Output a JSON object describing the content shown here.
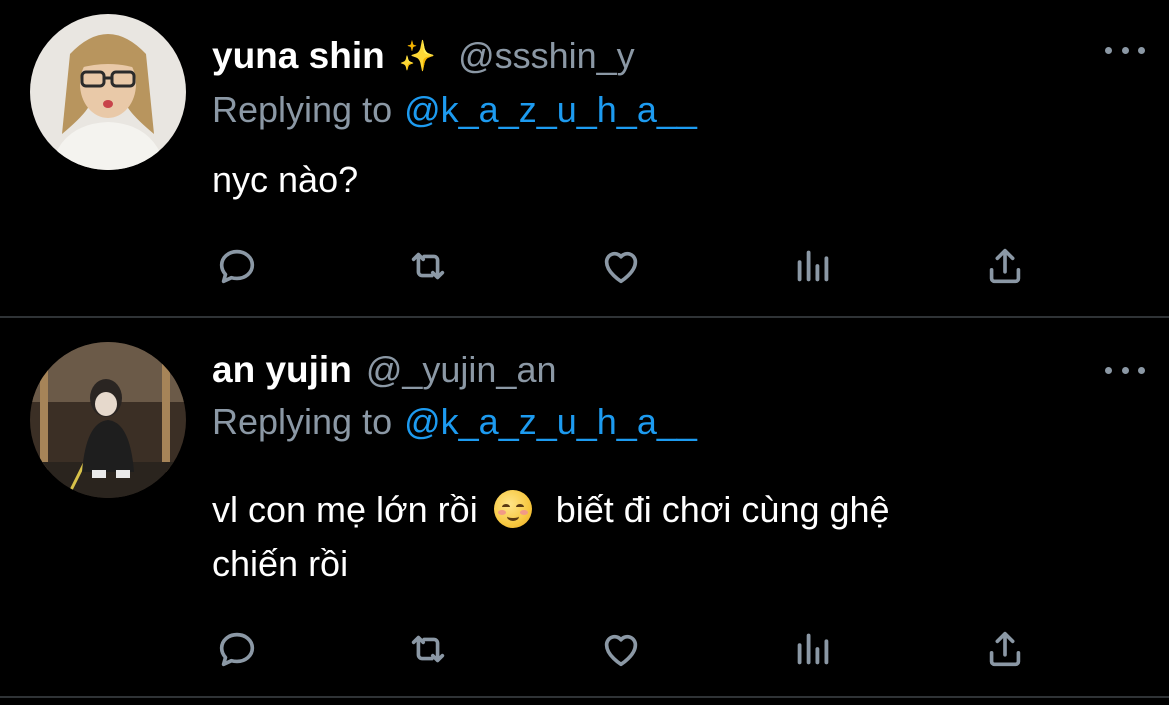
{
  "tweets": [
    {
      "display_name": "yuna shin",
      "name_emoji": "✨",
      "handle": "@ssshin_y",
      "reply_prefix": "Replying to",
      "reply_target": "@k_a_z_u_h_a__",
      "body_line1": "nyc nào?",
      "avatar": "avatar-woman-glasses"
    },
    {
      "display_name": "an yujin",
      "handle": "@_yujin_an",
      "reply_prefix": "Replying to",
      "reply_target": "@k_a_z_u_h_a__",
      "body_part1": "vl con mẹ lớn rồi",
      "body_emoji": "smiling-face-blush-emoji",
      "body_part2": "biết đi chơi cùng ghệ",
      "body_line2": "chiến rồi",
      "avatar": "avatar-person-crouching"
    }
  ],
  "icons": [
    "reply-icon",
    "retweet-icon",
    "like-icon",
    "stats-icon",
    "share-icon",
    "more-icon"
  ],
  "colors": {
    "background": "#000000",
    "text": "#ffffff",
    "secondary": "#8b98a5",
    "link": "#1d9bf0",
    "divider": "#2f3336"
  }
}
